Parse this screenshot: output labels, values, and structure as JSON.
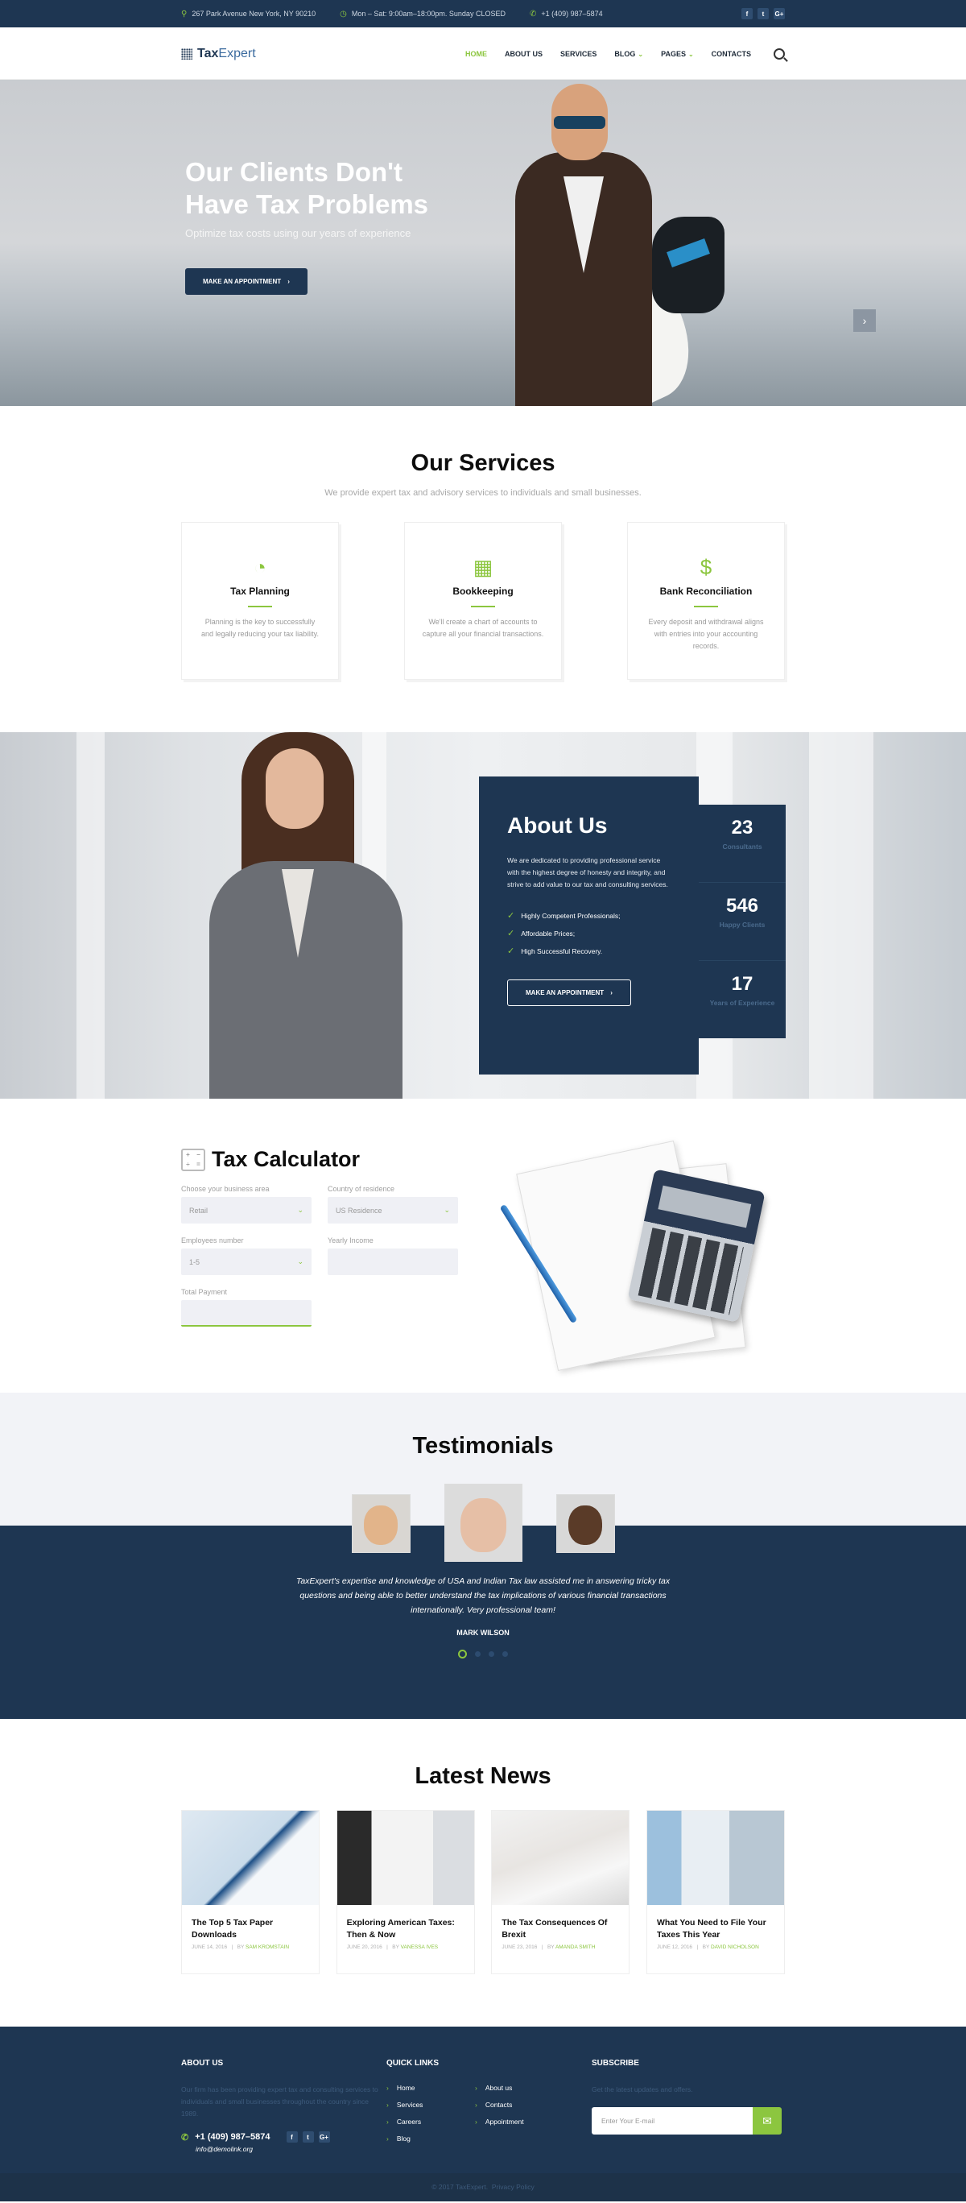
{
  "topbar": {
    "address": "267 Park Avenue New York, NY 90210",
    "hours": "Mon – Sat: 9:00am–18:00pm. Sunday CLOSED",
    "phone": "+1 (409) 987–5874",
    "social": [
      "f",
      "t",
      "G+"
    ]
  },
  "nav": {
    "logo_a": "Tax",
    "logo_b": "Expert",
    "items": [
      {
        "label": "HOME",
        "active": true
      },
      {
        "label": "ABOUT US"
      },
      {
        "label": "SERVICES"
      },
      {
        "label": "BLOG",
        "dropdown": true
      },
      {
        "label": "PAGES",
        "dropdown": true
      },
      {
        "label": "CONTACTS"
      }
    ],
    "chevron": "⌄"
  },
  "hero": {
    "title_line1": "Our Clients Don't",
    "title_line2": "Have Tax Problems",
    "subtitle": "Optimize tax costs using our years of experience",
    "cta": "MAKE AN APPOINTMENT",
    "cta_arrow": "›",
    "next_arrow": "›"
  },
  "services": {
    "title": "Our Services",
    "subtitle": "We provide expert tax and advisory services to individuals and small businesses.",
    "cards": [
      {
        "icon": "pie-chart-icon",
        "glyph": "◔",
        "title": "Tax Planning",
        "text": "Planning is the key to successfully and legally reducing your tax liability."
      },
      {
        "icon": "calculator-icon",
        "glyph": "▦",
        "title": "Bookkeeping",
        "text": "We'll create a chart of accounts to capture all your financial transactions."
      },
      {
        "icon": "money-bag-icon",
        "glyph": "$",
        "title": "Bank Reconciliation",
        "text": "Every deposit and withdrawal aligns with entries into your accounting records."
      }
    ]
  },
  "about": {
    "title": "About Us",
    "text": "We are dedicated to providing professional service with the highest degree of honesty and integrity, and strive to add value to our tax and consulting services.",
    "list": [
      "Highly Competent Professionals;",
      "Affordable Prices;",
      "High Successful Recovery."
    ],
    "check": "✓",
    "cta": "MAKE AN APPOINTMENT",
    "cta_arrow": "›",
    "stats": [
      {
        "num": "23",
        "label": "Consultants"
      },
      {
        "num": "546",
        "label": "Happy Clients"
      },
      {
        "num": "17",
        "label": "Years of Experience"
      }
    ]
  },
  "calculator": {
    "title": "Tax Calculator",
    "icon_glyphs": [
      "+",
      "−",
      "÷",
      "="
    ],
    "fields": [
      {
        "label": "Choose your business area",
        "value": "Retail",
        "select": true
      },
      {
        "label": "Country of residence",
        "value": "US Residence",
        "select": true
      },
      {
        "label": "Employees number",
        "value": "1-5",
        "select": true
      },
      {
        "label": "Yearly Income",
        "value": ""
      },
      {
        "label": "Total Payment",
        "value": ""
      }
    ],
    "chevron": "⌄"
  },
  "testimonials": {
    "title": "Testimonials",
    "quote": "TaxExpert's expertise and knowledge of USA and Indian Tax law assisted me in answering tricky tax questions and being able to better understand the tax implications of various financial transactions internationally. Very professional team!",
    "author": "MARK WILSON",
    "active_index": 0,
    "total": 4
  },
  "news": {
    "title": "Latest News",
    "posts": [
      {
        "title": "The Top 5 Tax Paper Downloads",
        "date": "JUNE 14, 2016",
        "author": "SAM KROMSTAIN"
      },
      {
        "title": "Exploring American Taxes: Then & Now",
        "date": "JUNE 20, 2016",
        "author": "VANESSA IVES"
      },
      {
        "title": "The Tax Consequences Of Brexit",
        "date": "JUNE 23, 2016",
        "author": "AMANDA SMITH"
      },
      {
        "title": "What You Need to File Your Taxes This Year",
        "date": "JUNE 12, 2016",
        "author": "DAVID NICHOLSON"
      }
    ],
    "sep": "|",
    "by": "BY "
  },
  "footer": {
    "about_title": "ABOUT US",
    "about_text": "Our firm has been providing expert tax and consulting services to individuals and small businesses throughout the country since 1989.",
    "phone": "+1 (409) 987–5874",
    "email": "info@demolink.org",
    "social": [
      "f",
      "t",
      "G+"
    ],
    "links_title": "QUICK LINKS",
    "links": [
      "Home",
      "About us",
      "Services",
      "Contacts",
      "Careers",
      "Appointment",
      "Blog"
    ],
    "link_arrow": "›",
    "subscribe_title": "SUBSCRIBE",
    "subscribe_text": "Get the latest updates and offers.",
    "email_placeholder": "Enter Your E-mail",
    "copyright": "© 2017 TaxExpert.",
    "privacy": "Privacy Policy"
  },
  "colors": {
    "navy": "#1e3652",
    "accent": "#8cc63f"
  }
}
